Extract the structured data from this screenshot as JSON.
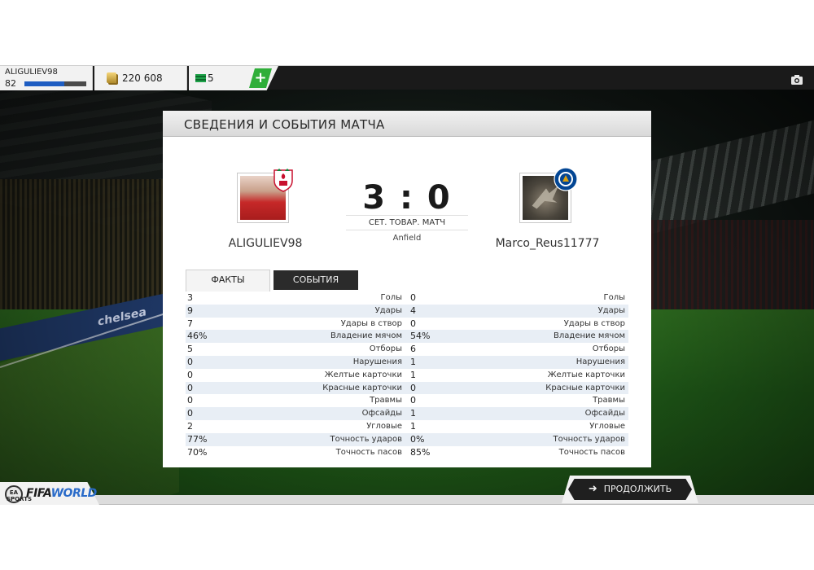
{
  "topbar": {
    "username": "ALIGULIEV98",
    "level": "82",
    "xp_progress": 0.65,
    "coins": "220 608",
    "points": "5",
    "add_button": "+",
    "icons": {
      "coins": "coin-stack-icon",
      "points": "fifa-points-icon",
      "camera": "camera-icon"
    }
  },
  "panel": {
    "title": "СВЕДЕНИЯ И СОБЫТИЯ МАТЧА",
    "score": "3 : 0",
    "match_type": "СЕТ. ТОВАР. МАТЧ",
    "venue": "Anfield",
    "home": {
      "name": "ALIGULIEV98",
      "crest": "liverpool-crest-icon",
      "crest_color": "#c8102e"
    },
    "away": {
      "name": "Marco_Reus11777",
      "crest": "chelsea-crest-icon",
      "crest_color": "#034694"
    },
    "tabs": [
      {
        "label": "ФАКТЫ",
        "active": true
      },
      {
        "label": "СОБЫТИЯ",
        "active": false
      }
    ],
    "stats": [
      {
        "label": "Голы",
        "home": "3",
        "away": "0"
      },
      {
        "label": "Удары",
        "home": "9",
        "away": "4"
      },
      {
        "label": "Удары в створ",
        "home": "7",
        "away": "0"
      },
      {
        "label": "Владение мячом",
        "home": "46%",
        "away": "54%"
      },
      {
        "label": "Отборы",
        "home": "5",
        "away": "6"
      },
      {
        "label": "Нарушения",
        "home": "0",
        "away": "1"
      },
      {
        "label": "Желтые карточки",
        "home": "0",
        "away": "1"
      },
      {
        "label": "Красные карточки",
        "home": "0",
        "away": "0"
      },
      {
        "label": "Травмы",
        "home": "0",
        "away": "0"
      },
      {
        "label": "Офсайды",
        "home": "0",
        "away": "1"
      },
      {
        "label": "Угловые",
        "home": "2",
        "away": "1"
      },
      {
        "label": "Точность ударов",
        "home": "77%",
        "away": "0%"
      },
      {
        "label": "Точность пасов",
        "home": "70%",
        "away": "85%"
      }
    ]
  },
  "footer": {
    "ea_badge": "EA SPORTS",
    "logo_fifa": "FIFA",
    "logo_world": "WORLD",
    "continue_label": "ПРОДОЛЖИТЬ",
    "continue_icon": "arrow-right-icon"
  },
  "stadium": {
    "adboard_text": "chelsea"
  },
  "colors": {
    "accent_green": "#2fae39",
    "xp_blue": "#1e5dc2",
    "link_blue": "#2a6bc9"
  }
}
